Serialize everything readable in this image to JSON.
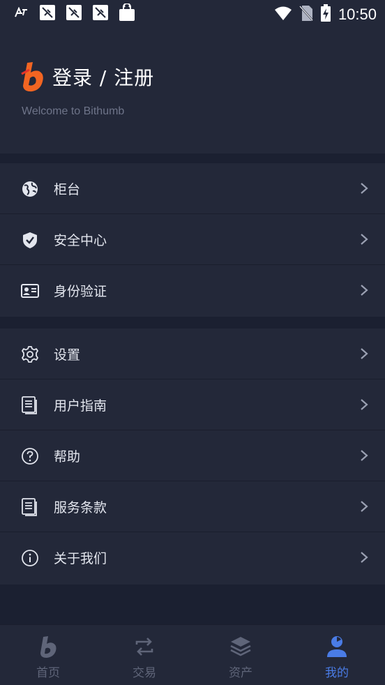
{
  "status_bar": {
    "time": "10:50"
  },
  "header": {
    "title": "登录 / 注册",
    "subtitle": "Welcome to Bithumb"
  },
  "menu_group_1": [
    {
      "label": "柜台",
      "icon": "globe-icon"
    },
    {
      "label": "安全中心",
      "icon": "shield-icon"
    },
    {
      "label": "身份验证",
      "icon": "id-card-icon"
    }
  ],
  "menu_group_2": [
    {
      "label": "设置",
      "icon": "gear-icon"
    },
    {
      "label": "用户指南",
      "icon": "document-icon"
    },
    {
      "label": "帮助",
      "icon": "help-icon"
    },
    {
      "label": "服务条款",
      "icon": "document-icon"
    },
    {
      "label": "关于我们",
      "icon": "info-icon"
    }
  ],
  "tabs": [
    {
      "label": "首页",
      "icon": "home-logo-icon",
      "active": false
    },
    {
      "label": "交易",
      "icon": "exchange-icon",
      "active": false
    },
    {
      "label": "资产",
      "icon": "layers-icon",
      "active": false
    },
    {
      "label": "我的",
      "icon": "profile-icon",
      "active": true
    }
  ],
  "colors": {
    "background": "#1b2031",
    "panel": "#232839",
    "accent_blue": "#4a7ce6",
    "brand_orange": "#f26522",
    "muted_text": "#6e7489"
  }
}
